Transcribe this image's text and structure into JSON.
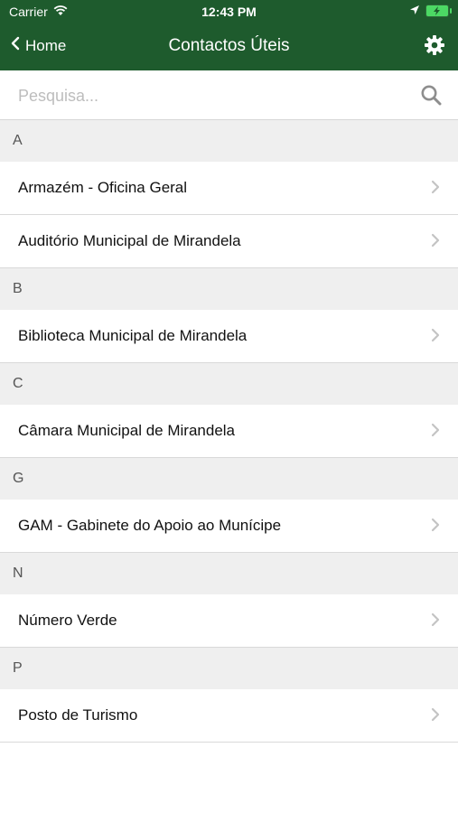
{
  "status_bar": {
    "carrier": "Carrier",
    "time": "12:43 PM",
    "wifi_icon": "wifi-icon",
    "location_icon": "location-icon",
    "battery_icon": "battery-charging-icon"
  },
  "nav": {
    "back_label": "Home",
    "title": "Contactos Úteis",
    "settings_icon": "gear-icon",
    "background_color": "#1e5b2d"
  },
  "search": {
    "placeholder": "Pesquisa...",
    "value": "",
    "icon": "search-icon"
  },
  "sections": [
    {
      "letter": "A",
      "items": [
        {
          "label": "Armazém - Oficina Geral"
        },
        {
          "label": "Auditório Municipal de Mirandela"
        }
      ]
    },
    {
      "letter": "B",
      "items": [
        {
          "label": "Biblioteca Municipal de Mirandela"
        }
      ]
    },
    {
      "letter": "C",
      "items": [
        {
          "label": "Câmara Municipal de Mirandela"
        }
      ]
    },
    {
      "letter": "G",
      "items": [
        {
          "label": "GAM - Gabinete do Apoio ao Munícipe"
        }
      ]
    },
    {
      "letter": "N",
      "items": [
        {
          "label": "Número Verde"
        }
      ]
    },
    {
      "letter": "P",
      "items": [
        {
          "label": "Posto de Turismo"
        }
      ]
    }
  ]
}
